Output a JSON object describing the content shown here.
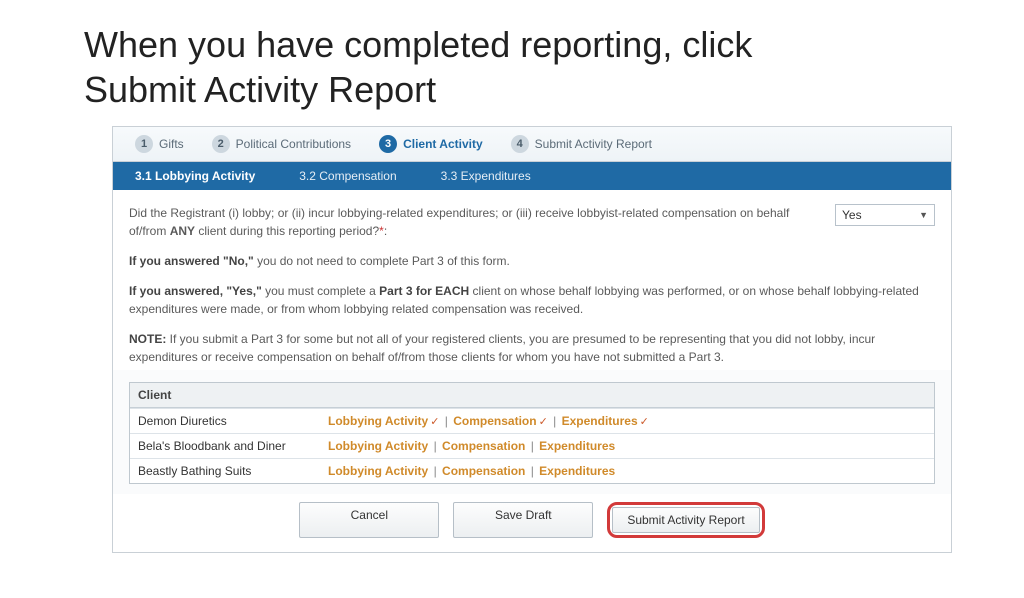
{
  "title": "When you have completed reporting, click Submit Activity Report",
  "stepper": [
    {
      "num": "1",
      "label": "Gifts"
    },
    {
      "num": "2",
      "label": "Political Contributions"
    },
    {
      "num": "3",
      "label": "Client Activity"
    },
    {
      "num": "4",
      "label": "Submit Activity Report"
    }
  ],
  "subtabs": [
    {
      "label": "3.1 Lobbying Activity"
    },
    {
      "label": "3.2 Compensation"
    },
    {
      "label": "3.3 Expenditures"
    }
  ],
  "question": {
    "pre": "Did the Registrant (i) lobby; or (ii) incur lobbying-related expenditures; or (iii) receive lobbyist-related compensation on behalf of/from ",
    "any": "ANY",
    "post": " client during this reporting period?",
    "star": "*",
    "colon": ":"
  },
  "dropdown": {
    "value": "Yes"
  },
  "p_no_lead": "If you answered \"No,\"",
  "p_no_rest": " you do not need to complete Part 3 of this form.",
  "p_yes_lead": "If you answered, \"Yes,\"",
  "p_yes_mid1": " you must complete a ",
  "p_yes_bold": "Part 3 for EACH",
  "p_yes_rest": " client on whose behalf lobbying was performed, or on whose behalf lobbying-related expenditures were made, or from whom lobbying related compensation was received.",
  "p_note_lead": "NOTE:",
  "p_note_rest": " If you submit a Part 3 for some but not all of your registered clients, you are presumed to be representing that you did not lobby, incur expenditures or receive compensation on behalf of/from those clients for whom you have not submitted a Part 3.",
  "client_header": "Client",
  "link_labels": {
    "la": "Lobbying Activity",
    "comp": "Compensation",
    "exp": "Expenditures"
  },
  "check": "✓",
  "sep": " | ",
  "clients": [
    {
      "name": "Demon Diuretics",
      "checked": true
    },
    {
      "name": "Bela's Bloodbank and Diner",
      "checked": false
    },
    {
      "name": "Beastly Bathing Suits",
      "checked": false
    }
  ],
  "buttons": {
    "cancel": "Cancel",
    "save": "Save Draft",
    "submit": "Submit Activity Report"
  }
}
